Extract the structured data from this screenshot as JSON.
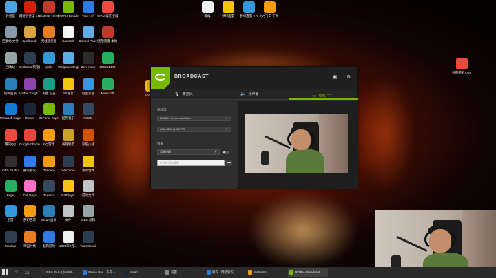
{
  "desktop": {
    "left_icons": [
      {
        "label": "此电脑",
        "color": "#4aa3df"
      },
      {
        "label": "网易云音乐 ADB",
        "color": "#d81e06"
      },
      {
        "label": "WinRAR USB调试",
        "color": "#c0392b"
      },
      {
        "label": "NVIDIA Broadcast",
        "color": "#76b900"
      },
      {
        "label": "Xiao Lab",
        "color": "#2d7be5"
      },
      {
        "label": "SGW 海信 加速器",
        "color": "#e74c3c"
      },
      {
        "label": "回收站 文件",
        "color": "#8899aa"
      },
      {
        "label": "Spellbreak",
        "color": "#d9a441"
      },
      {
        "label": "无线遥控器",
        "color": "#e67e22"
      },
      {
        "label": "CamHub",
        "color": "#f4f4f4"
      },
      {
        "label": "Control Panel",
        "color": "#5dade2"
      },
      {
        "label": "无限速度 本地",
        "color": "#c0392b"
      },
      {
        "label": "回收站",
        "color": "#95a5a6"
      },
      {
        "label": "Craftopia 快速启动",
        "color": "#2c3e50"
      },
      {
        "label": "Uplay",
        "color": "#3498db"
      },
      {
        "label": "Wallpaper Engine",
        "color": "#5dade2"
      },
      {
        "label": "Zero Hour",
        "color": "#2c2c2c"
      },
      {
        "label": "2560X1440",
        "color": "#27ae60"
      },
      {
        "label": "控制面板",
        "color": "#2980b9"
      },
      {
        "label": "Hades Tough Life",
        "color": "#8e44ad"
      },
      {
        "label": "美图 设置",
        "color": "#16a085"
      },
      {
        "label": "YY语音",
        "color": "#f1c40f"
      },
      {
        "label": "阿里云盘",
        "color": "#3498db"
      },
      {
        "label": "Minecraft",
        "color": "#27ae60"
      },
      {
        "label": "Microsoft Edge",
        "color": "#0f7cd6"
      },
      {
        "label": "Steam",
        "color": "#1b2838"
      },
      {
        "label": "GeForce Experience",
        "color": "#76b900"
      },
      {
        "label": "酷狗音乐",
        "color": "#2980b9"
      },
      {
        "label": "NetMe",
        "color": "#34495e"
      },
      {
        "label": "",
        "color": "#000000"
      },
      {
        "label": "腾讯QQ",
        "color": "#e74c3c"
      },
      {
        "label": "Google Chrome",
        "color": "#e8453c"
      },
      {
        "label": "QQ游戏",
        "color": "#f39c12"
      },
      {
        "label": "英雄联盟",
        "color": "#c9a227"
      },
      {
        "label": "穿越火线",
        "color": "#d35400"
      },
      {
        "label": "",
        "color": "#000000"
      },
      {
        "label": "OBS Studio",
        "color": "#302e31"
      },
      {
        "label": "腾讯会议",
        "color": "#2d7be5"
      },
      {
        "label": "Tencent",
        "color": "#f39c12"
      },
      {
        "label": "WeGame",
        "color": "#2c3e50"
      },
      {
        "label": "我的世界",
        "color": "#f1c40f"
      },
      {
        "label": "",
        "color": "#000000"
      },
      {
        "label": "Edge",
        "color": "#27ae60"
      },
      {
        "label": "Fall Guys",
        "color": "#ff6ec7"
      },
      {
        "label": "Tencent",
        "color": "#34495e"
      },
      {
        "label": "PotPlayer",
        "color": "#f5c518"
      },
      {
        "label": "游戏文件",
        "color": "#bdc3c7"
      },
      {
        "label": "",
        "color": "#000000"
      },
      {
        "label": "迅雷",
        "color": "#3498db"
      },
      {
        "label": "梦幻西游",
        "color": "#f39c12"
      },
      {
        "label": "Steam启动",
        "color": "#2980b9"
      },
      {
        "label": "文件",
        "color": "#bdc3c7"
      },
      {
        "label": "OBS 录制",
        "color": "#95a5a6"
      },
      {
        "label": "",
        "color": "#000000"
      },
      {
        "label": "Creative",
        "color": "#2c3e50"
      },
      {
        "label": "帝国时代",
        "color": "#e67e22"
      },
      {
        "label": "酷狗游戏",
        "color": "#2d7be5"
      },
      {
        "label": "2020年7月...",
        "color": "#ecf0f1"
      },
      {
        "label": "TeamSpeak",
        "color": "#2c3e50"
      },
      {
        "label": "",
        "color": "#000000"
      },
      {
        "label": "Modern Warfare",
        "color": "#1c1c1c"
      },
      {
        "label": "Origin",
        "color": "#f56c2d"
      },
      {
        "label": "Steam 库",
        "color": "#bdc3c7"
      },
      {
        "label": "网易云音乐",
        "color": "#e60026"
      },
      {
        "label": "Epic Games Launcher",
        "color": "#111111"
      },
      {
        "label": "",
        "color": "#000000"
      }
    ],
    "top_icons": [
      {
        "label": "网络",
        "color": "#ecf0f1"
      },
      {
        "label": "梦幻西游",
        "color": "#f1c40f"
      },
      {
        "label": "梦幻西游 2.0",
        "color": "#3498db"
      },
      {
        "label": "QQ飞车 工具",
        "color": "#f39c12"
      }
    ],
    "right_icon": {
      "label": "有用说明 OBS.mp4",
      "color": "#e74c3c"
    },
    "partial_icon": {
      "label": "QQ飞车",
      "color": "#f1c40f"
    }
  },
  "broadcast": {
    "app_title": "BROADCAST",
    "tabs": [
      {
        "label": "麦克风",
        "icon": "mic-icon"
      },
      {
        "label": "扬声器",
        "icon": "speaker-icon"
      },
      {
        "label": "相机",
        "icon": "camera-icon",
        "badge": "BETA"
      }
    ],
    "left_panel": {
      "source_label": "视频源",
      "source_value": "BC1000 ConferenceCam",
      "resolution_value": "640 x 360 @ 30FPS",
      "effect_label": "效果",
      "effect_value": "背景模糊",
      "path_placeholder": "在此处添加背景"
    }
  },
  "taskbar": {
    "items": [
      {
        "label": "OBS 25.0.8 (64-bit...",
        "color": "#302e31"
      },
      {
        "label": "Studio One - 未命...",
        "color": "#2d7be5"
      },
      {
        "label": "Steam",
        "color": "#1b2838"
      },
      {
        "label": "设置",
        "color": "#888888"
      },
      {
        "label": "聊天 - 网络聊天",
        "color": "#2d7be5"
      },
      {
        "label": "WeGame",
        "color": "#f39c12"
      },
      {
        "label": "NVIDIA Broadcast",
        "color": "#76b900"
      }
    ]
  }
}
